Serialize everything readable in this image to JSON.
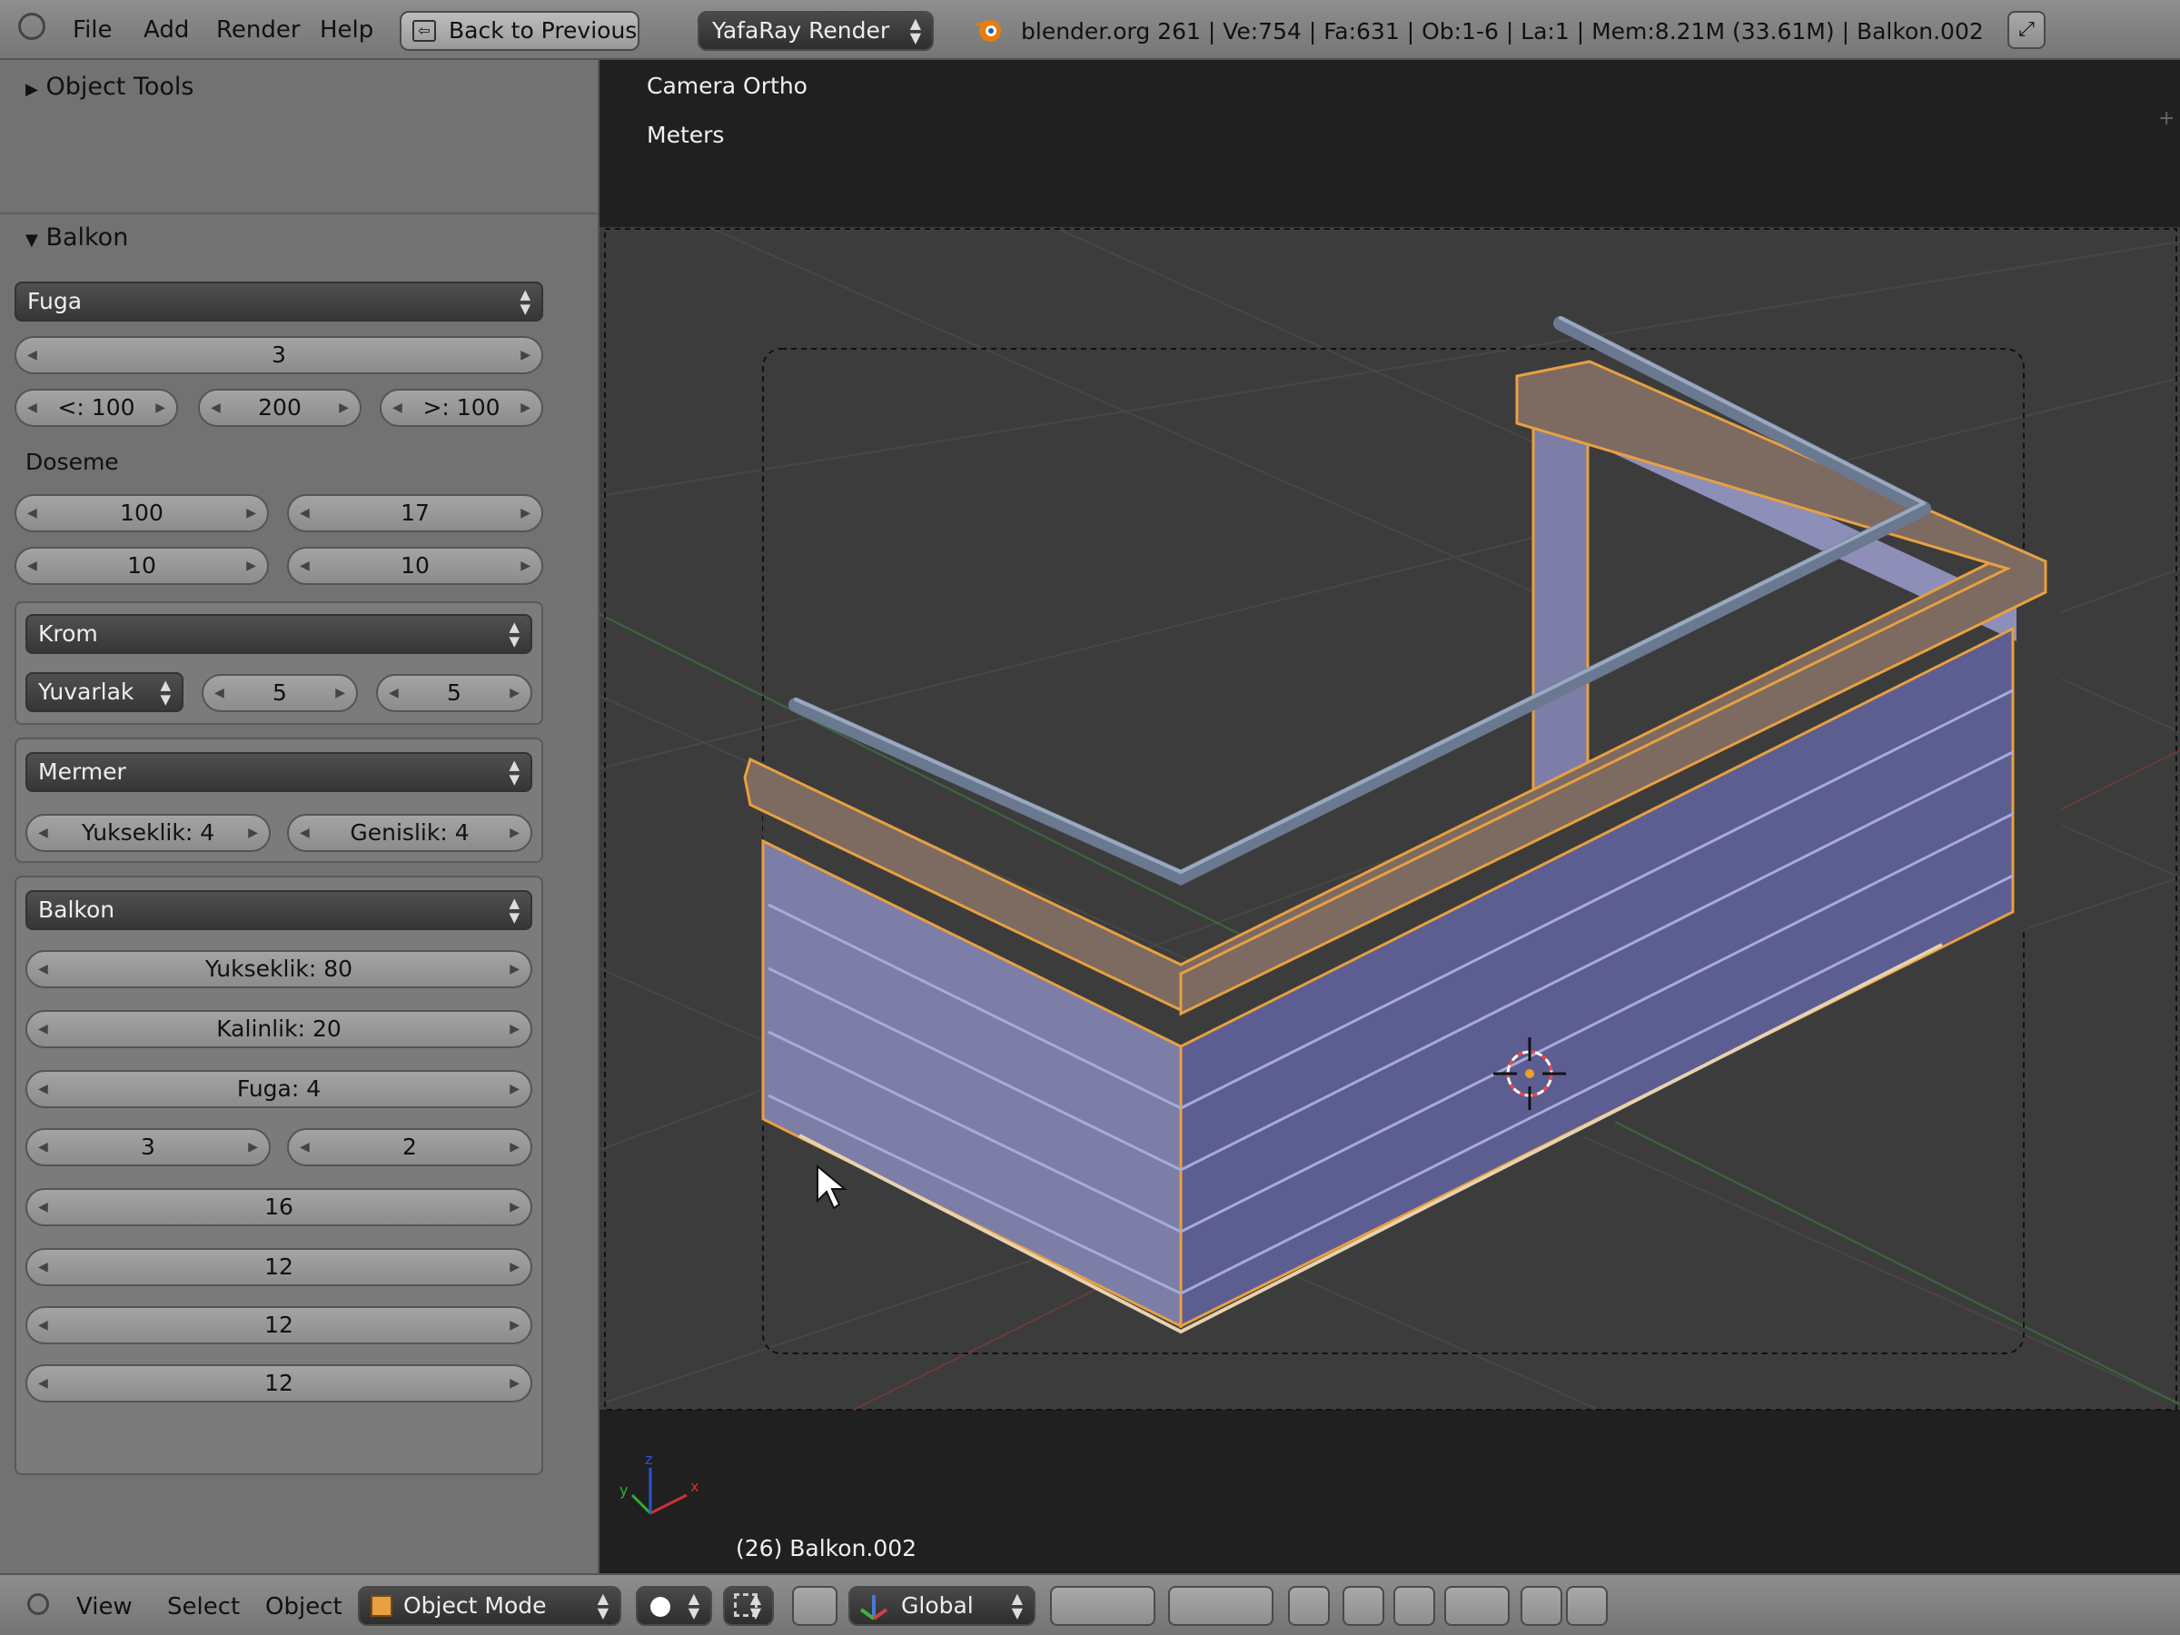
{
  "header": {
    "menus": [
      "File",
      "Add",
      "Render",
      "Help"
    ],
    "back_button": "Back to Previous",
    "render_engine": "YafaRay Render",
    "stats": "blender.org 261 | Ve:754 | Fa:631 | Ob:1-6 | La:1 | Mem:8.21M (33.61M) | Balkon.002"
  },
  "toolshelf": {
    "object_tools": "Object Tools",
    "panel_title": "Balkon",
    "fuga_select": "Fuga",
    "fuga_count": "3",
    "fuga_left": "<: 100",
    "fuga_mid": "200",
    "fuga_right": ">: 100",
    "doseme_label": "Doseme",
    "doseme_1": "100",
    "doseme_2": "17",
    "doseme_3": "10",
    "doseme_4": "10",
    "krom_select": "Krom",
    "yuvarlak_select": "Yuvarlak",
    "krom_a": "5",
    "krom_b": "5",
    "mermer_select": "Mermer",
    "yukseklik": "Yukseklik: 4",
    "genislik": "Genislik: 4",
    "balkon_select": "Balkon",
    "balkon_yukseklik": "Yukseklik: 80",
    "kalinlik": "Kalinlik: 20",
    "balkon_fuga": "Fuga: 4",
    "val_3": "3",
    "val_2": "2",
    "val_16": "16",
    "val_12a": "12",
    "val_12b": "12",
    "val_12c": "12"
  },
  "viewport": {
    "view_name": "Camera Ortho",
    "units": "Meters",
    "object_info": "(26) Balkon.002",
    "axis_x": "x",
    "axis_y": "y",
    "axis_z": "z"
  },
  "footer": {
    "menus": [
      "View",
      "Select",
      "Object"
    ],
    "mode": "Object Mode",
    "orientation": "Global"
  },
  "colors": {
    "object_outline": "#e8a040",
    "wall_left": "#7c7ea8",
    "wall_right": "#5c5e92",
    "cap": "#7d6a60",
    "rail": "#6a7890"
  }
}
